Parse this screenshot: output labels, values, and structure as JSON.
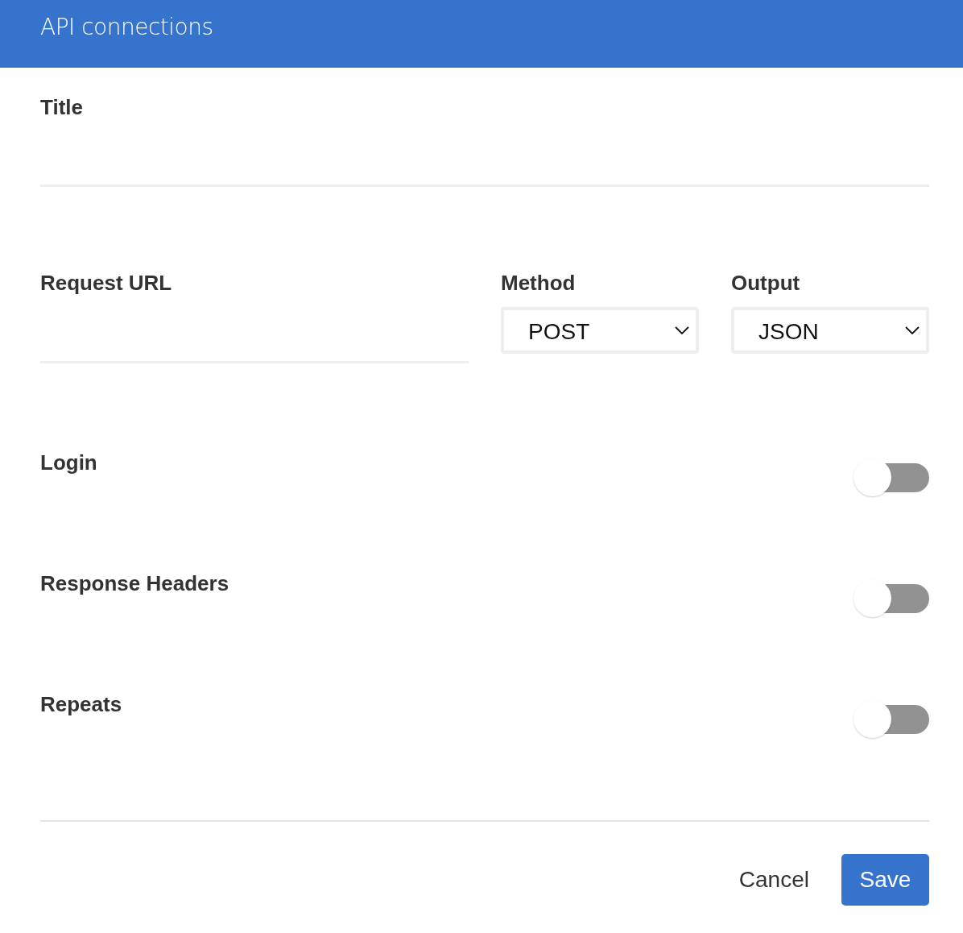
{
  "dialog": {
    "title": "API connections"
  },
  "title_field": {
    "label": "Title"
  },
  "request_url_field": {
    "label": "Request URL"
  },
  "selects": [
    {
      "label": "Method",
      "value": "POST"
    },
    {
      "label": "Output",
      "value": "JSON"
    }
  ],
  "toggles": [
    {
      "label": "Login",
      "on": false
    },
    {
      "label": "Response Headers",
      "on": false
    },
    {
      "label": "Repeats",
      "on": false
    }
  ],
  "buttons": [
    {
      "label": "Cancel",
      "kind": "text"
    },
    {
      "label": "Save",
      "kind": "primary"
    }
  ]
}
